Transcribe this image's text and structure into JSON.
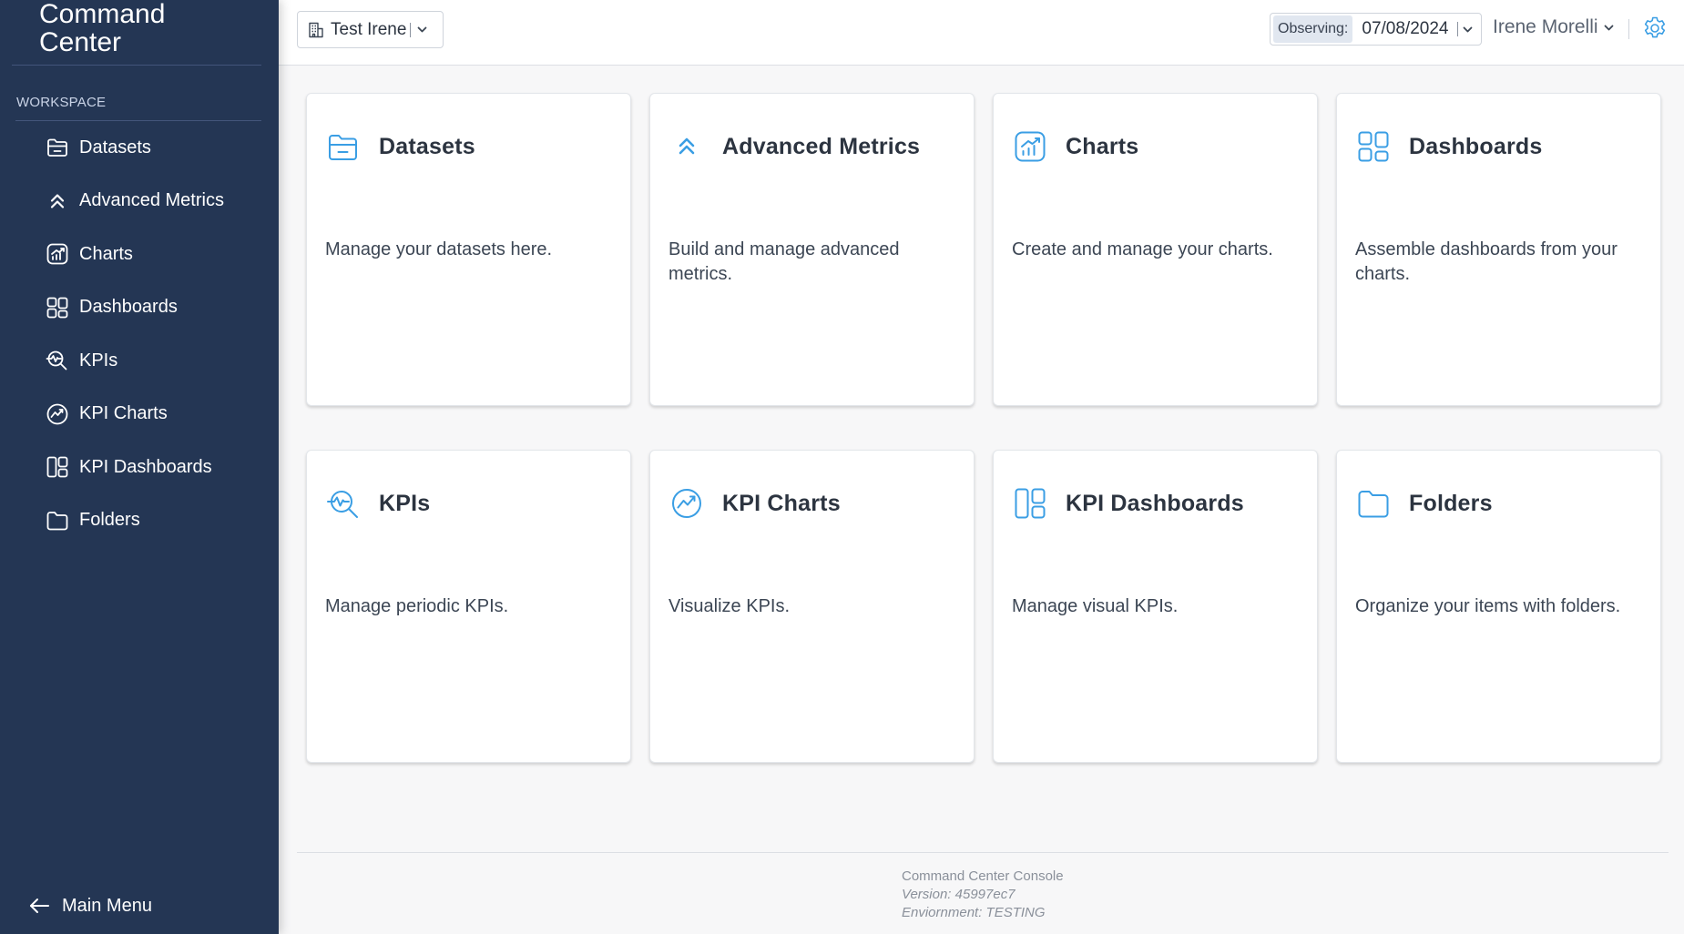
{
  "sidebar": {
    "brand": "Command Center",
    "section_label": "WORKSPACE",
    "items": [
      {
        "label": "Datasets",
        "icon": "datasets-icon"
      },
      {
        "label": "Advanced Metrics",
        "icon": "advanced-metrics-icon"
      },
      {
        "label": "Charts",
        "icon": "charts-icon"
      },
      {
        "label": "Dashboards",
        "icon": "dashboards-icon"
      },
      {
        "label": "KPIs",
        "icon": "kpis-icon"
      },
      {
        "label": "KPI Charts",
        "icon": "kpi-charts-icon"
      },
      {
        "label": "KPI Dashboards",
        "icon": "kpi-dashboards-icon"
      },
      {
        "label": "Folders",
        "icon": "folder-icon"
      }
    ],
    "main_menu": "Main Menu"
  },
  "topbar": {
    "workspace": "Test Irene",
    "observing_label": "Observing:",
    "observing_date": "07/08/2024",
    "user": "Irene Morelli"
  },
  "cards": [
    {
      "title": "Datasets",
      "desc": "Manage your datasets here.",
      "icon": "datasets-icon"
    },
    {
      "title": "Advanced Metrics",
      "desc": "Build and manage advanced metrics.",
      "icon": "advanced-metrics-icon"
    },
    {
      "title": "Charts",
      "desc": "Create and manage your charts.",
      "icon": "charts-icon"
    },
    {
      "title": "Dashboards",
      "desc": "Assemble dashboards from your charts.",
      "icon": "dashboards-icon"
    },
    {
      "title": "KPIs",
      "desc": "Manage periodic KPIs.",
      "icon": "kpis-icon"
    },
    {
      "title": "KPI Charts",
      "desc": "Visualize KPIs.",
      "icon": "kpi-charts-icon"
    },
    {
      "title": "KPI Dashboards",
      "desc": "Manage visual KPIs.",
      "icon": "kpi-dashboards-icon"
    },
    {
      "title": "Folders",
      "desc": "Organize your items with folders.",
      "icon": "folder-icon"
    }
  ],
  "footer": {
    "app": "Command Center Console",
    "version": "Version: 45997ec7",
    "environment": "Enviornment: TESTING"
  },
  "colors": {
    "sidebar_bg": "#243654",
    "accent": "#3a9ee4",
    "page_bg": "#f7f7f8"
  }
}
